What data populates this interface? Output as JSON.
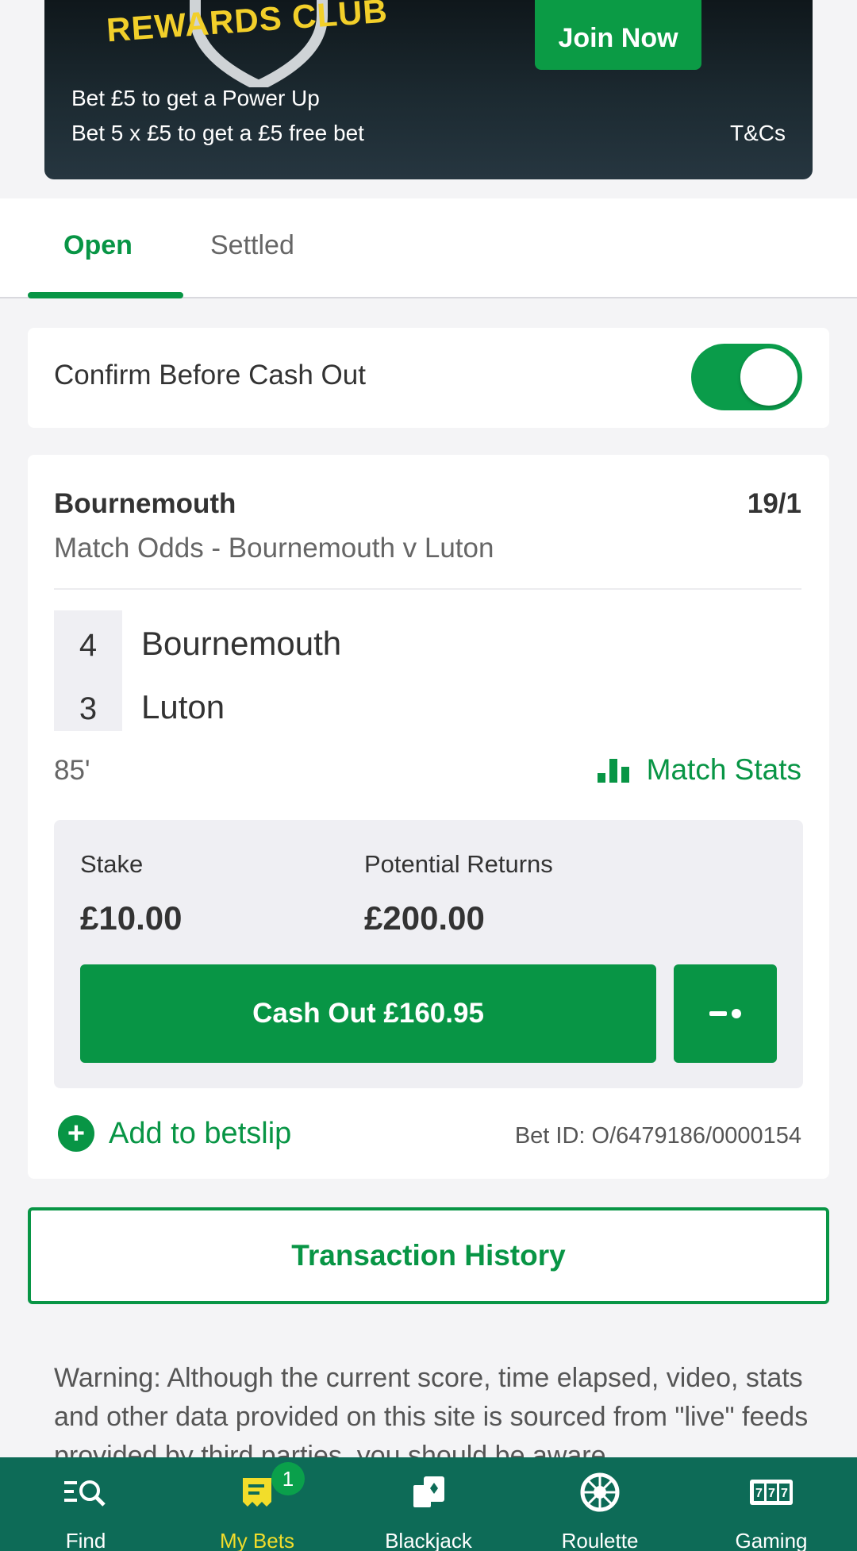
{
  "promo": {
    "club_text": "REWARDS CLUB",
    "line1": "Bet £5 to get a Power Up",
    "line2": "Bet 5 x £5 to get a £5 free bet",
    "tcs": "T&Cs",
    "join_label": "Join Now"
  },
  "tabs": [
    {
      "label": "Open",
      "active": true
    },
    {
      "label": "Settled",
      "active": false
    }
  ],
  "confirm": {
    "label": "Confirm Before Cash Out",
    "toggle_on": true
  },
  "bet": {
    "selection": "Bournemouth",
    "odds": "19/1",
    "market": "Match Odds - Bournemouth v Luton",
    "scores": [
      {
        "score": "4",
        "team": "Bournemouth"
      },
      {
        "score": "3",
        "team": "Luton"
      }
    ],
    "minute": "85'",
    "stats_label": "Match Stats",
    "stake_label": "Stake",
    "stake_value": "£10.00",
    "returns_label": "Potential Returns",
    "returns_value": "£200.00",
    "cashout_label": "Cash Out £160.95",
    "add_label": "Add to betslip",
    "bet_id": "Bet ID: O/6479186/0000154"
  },
  "transaction_label": "Transaction History",
  "warning_text": "Warning: Although the current score, time elapsed, video, stats and other data provided on this site is sourced from \"live\" feeds provided by third parties, you should be aware",
  "nav": [
    {
      "label": "Find",
      "icon": "find-icon"
    },
    {
      "label": "My Bets",
      "icon": "my-bets-icon",
      "badge": "1",
      "active": true
    },
    {
      "label": "Blackjack",
      "icon": "cards-icon"
    },
    {
      "label": "Roulette",
      "icon": "roulette-icon"
    },
    {
      "label": "Gaming",
      "icon": "slot-machine-icon"
    }
  ],
  "colors": {
    "brand_green": "#089545",
    "nav_bg": "#0d6b57",
    "active_nav": "#f2dd2a",
    "promo_yellow": "#f2cf2a"
  }
}
